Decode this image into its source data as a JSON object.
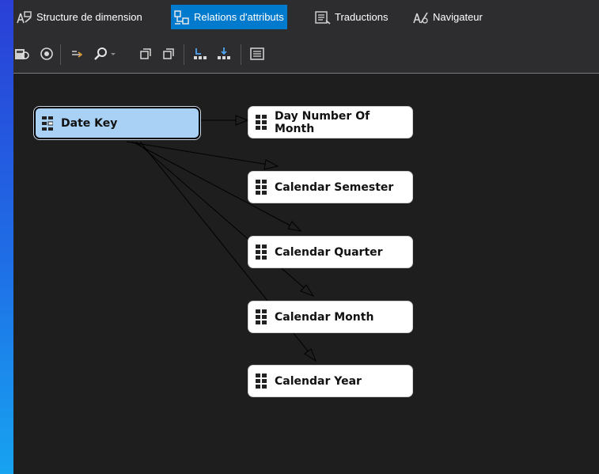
{
  "tabs": [
    {
      "label": "Structure de dimension",
      "icon": "dimension-structure-icon",
      "active": false
    },
    {
      "label": "Relations d'attributs",
      "icon": "attribute-relations-icon",
      "active": true
    },
    {
      "label": "Traductions",
      "icon": "translations-icon",
      "active": false
    },
    {
      "label": "Navigateur",
      "icon": "browser-icon",
      "active": false
    }
  ],
  "toolbar": {
    "buttons": [
      "process-icon",
      "deploy-icon",
      "new-relation-icon",
      "zoom-icon",
      "zoom-dropdown-icon",
      "fit-icon",
      "arrange-icon",
      "expand-icon",
      "collapse-icon",
      "properties-icon"
    ]
  },
  "diagram": {
    "source": {
      "label": "Date Key",
      "icon": "key-attribute-icon"
    },
    "attributes": [
      {
        "label": "Day Number Of Month",
        "icon": "attribute-icon"
      },
      {
        "label": "Calendar Semester",
        "icon": "attribute-icon"
      },
      {
        "label": "Calendar Quarter",
        "icon": "attribute-icon"
      },
      {
        "label": "Calendar Month",
        "icon": "attribute-icon"
      },
      {
        "label": "Calendar Year",
        "icon": "attribute-icon"
      }
    ]
  },
  "colors": {
    "background_gradient_top": "#2a3fd6",
    "background_gradient_bottom": "#17a3f0",
    "editor_bg": "#1e1e1e",
    "tabbar_bg": "#2d2d30",
    "active_tab": "#007acc",
    "key_node_fill": "#a9d1f5"
  }
}
